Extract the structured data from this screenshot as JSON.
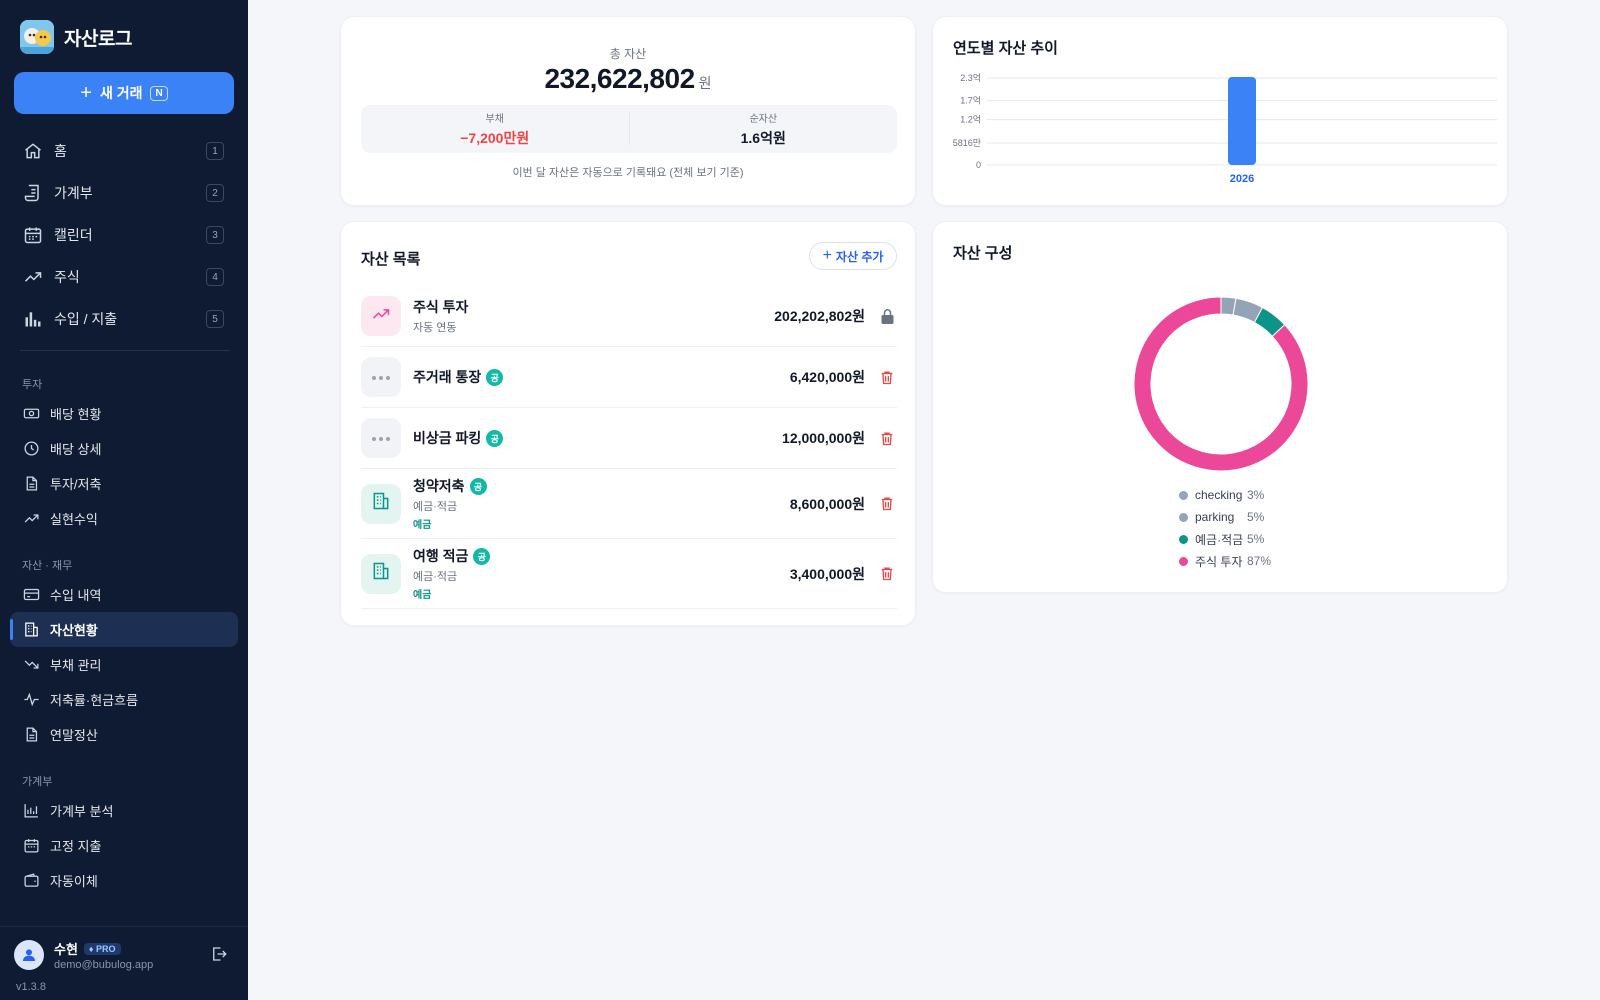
{
  "brand": {
    "name": "자산로그"
  },
  "new_button": {
    "label": "새 거래",
    "shortcut": "N"
  },
  "main_nav": [
    {
      "label": "홈",
      "shortcut": "1",
      "icon": "home-icon"
    },
    {
      "label": "가계부",
      "shortcut": "2",
      "icon": "receipt-icon"
    },
    {
      "label": "캘린더",
      "shortcut": "3",
      "icon": "calendar-icon"
    },
    {
      "label": "주식",
      "shortcut": "4",
      "icon": "trend-up-icon"
    },
    {
      "label": "수입 / 지출",
      "shortcut": "5",
      "icon": "bar-chart-icon"
    }
  ],
  "sections": {
    "invest": {
      "label": "투자",
      "items": [
        {
          "label": "배당 현황",
          "icon": "cash-icon"
        },
        {
          "label": "배당 상세",
          "icon": "clock-icon"
        },
        {
          "label": "투자/저축",
          "icon": "document-icon"
        },
        {
          "label": "실현수익",
          "icon": "trend-up-icon"
        }
      ]
    },
    "assets": {
      "label": "자산 · 재무",
      "items": [
        {
          "label": "수입 내역",
          "icon": "card-icon"
        },
        {
          "label": "자산현황",
          "icon": "building-icon",
          "active": true
        },
        {
          "label": "부채 관리",
          "icon": "trend-down-icon"
        },
        {
          "label": "저축률·현금흐름",
          "icon": "pulse-icon"
        },
        {
          "label": "연말정산",
          "icon": "document-icon"
        }
      ]
    },
    "ledger": {
      "label": "가계부",
      "items": [
        {
          "label": "가계부 분석",
          "icon": "bar-chart-icon"
        },
        {
          "label": "고정 지출",
          "icon": "calendar-icon"
        },
        {
          "label": "자동이체",
          "icon": "wallet-icon"
        }
      ]
    }
  },
  "user": {
    "name": "수현",
    "plan": "PRO",
    "email": "demo@bubulog.app",
    "version": "v1.3.8"
  },
  "summary": {
    "total_label": "총 자산",
    "total_value": "232,622,802",
    "total_unit": "원",
    "debt_label": "부채",
    "debt_value": "−7,200만원",
    "net_label": "순자산",
    "net_value": "1.6억원",
    "hint": "이번 달 자산은 자동으로 기록돼요 (전체 보기 기준)"
  },
  "trend": {
    "title": "연도별 자산 추이",
    "chart_data": {
      "type": "bar",
      "categories": [
        "2026"
      ],
      "values": [
        232622802
      ],
      "y_ticks": [
        {
          "value": 0,
          "label": "0"
        },
        {
          "value": 58160000,
          "label": "5816만"
        },
        {
          "value": 120000000,
          "label": "1.2억"
        },
        {
          "value": 170000000,
          "label": "1.7억"
        },
        {
          "value": 230000000,
          "label": "2.3억"
        }
      ],
      "ylim": [
        0,
        232622802
      ],
      "grid": true,
      "bar_color": "#3b82f6"
    }
  },
  "asset_list": {
    "title": "자산 목록",
    "add_label": "자산 추가",
    "badge_text": "공",
    "items": [
      {
        "name": "주식 투자",
        "desc": "자동 연동",
        "tag": "",
        "amount": "202,202,802원",
        "shared": false,
        "action": "lock-icon",
        "tile": "stock"
      },
      {
        "name": "주거래 통장",
        "desc": "",
        "tag": "",
        "amount": "6,420,000원",
        "shared": true,
        "action": "trash-icon",
        "tile": "more"
      },
      {
        "name": "비상금 파킹",
        "desc": "",
        "tag": "",
        "amount": "12,000,000원",
        "shared": true,
        "action": "trash-icon",
        "tile": "more"
      },
      {
        "name": "청약저축",
        "desc": "예금·적금",
        "tag": "예금",
        "amount": "8,600,000원",
        "shared": true,
        "action": "trash-icon",
        "tile": "bank"
      },
      {
        "name": "여행 적금",
        "desc": "예금·적금",
        "tag": "예금",
        "amount": "3,400,000원",
        "shared": true,
        "action": "trash-icon",
        "tile": "bank"
      }
    ]
  },
  "composition": {
    "title": "자산 구성",
    "chart_data": {
      "type": "pie",
      "donut": true,
      "slices": [
        {
          "name": "checking",
          "label": "3%",
          "value": 6420000,
          "color": "#94a3b8"
        },
        {
          "name": "parking",
          "label": "5%",
          "value": 12000000,
          "color": "#94a3b8"
        },
        {
          "name": "예금·적금",
          "label": "5%",
          "value": 12000000,
          "color": "#0d9488"
        },
        {
          "name": "주식 투자",
          "label": "87%",
          "value": 202202802,
          "color": "#ec4899"
        }
      ]
    }
  }
}
